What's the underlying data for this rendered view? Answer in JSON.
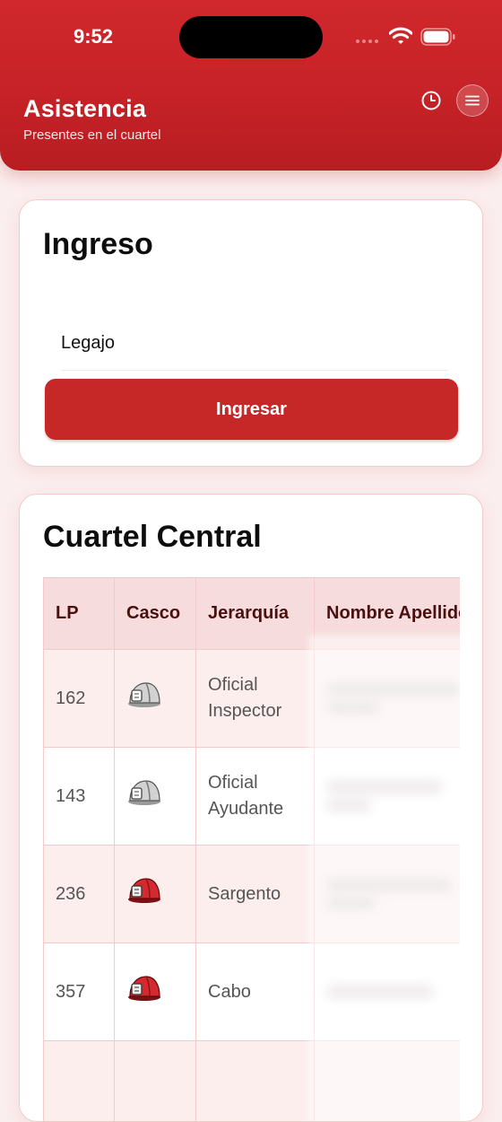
{
  "status_bar": {
    "time": "9:52"
  },
  "header": {
    "title": "Asistencia",
    "subtitle": "Presentes en el cuartel",
    "icons": {
      "history": "clock-icon",
      "menu": "hamburger-icon"
    }
  },
  "ingreso": {
    "title": "Ingreso",
    "legajo_placeholder": "Legajo",
    "button_label": "Ingresar"
  },
  "cuartel": {
    "title": "Cuartel Central",
    "columns": [
      "LP",
      "Casco",
      "Jerarquía",
      "Nombre Apellido"
    ],
    "rows": [
      {
        "lp": "162",
        "casco": "silver",
        "jerarquia": "Oficial Inspector"
      },
      {
        "lp": "143",
        "casco": "silver",
        "jerarquia": "Oficial Ayudante"
      },
      {
        "lp": "236",
        "casco": "red",
        "jerarquia": "Sargento"
      },
      {
        "lp": "357",
        "casco": "red",
        "jerarquia": "Cabo"
      },
      {
        "lp": "",
        "casco": "",
        "jerarquia": ""
      }
    ]
  },
  "colors": {
    "brand_red": "#c62828",
    "header_red": "#d0282c",
    "background": "#fbeeee",
    "table_header": "#f6dcdc",
    "row_alt": "#fdeeee",
    "helmet_silver": "#c9c9c9",
    "helmet_red": "#d42a2f"
  }
}
